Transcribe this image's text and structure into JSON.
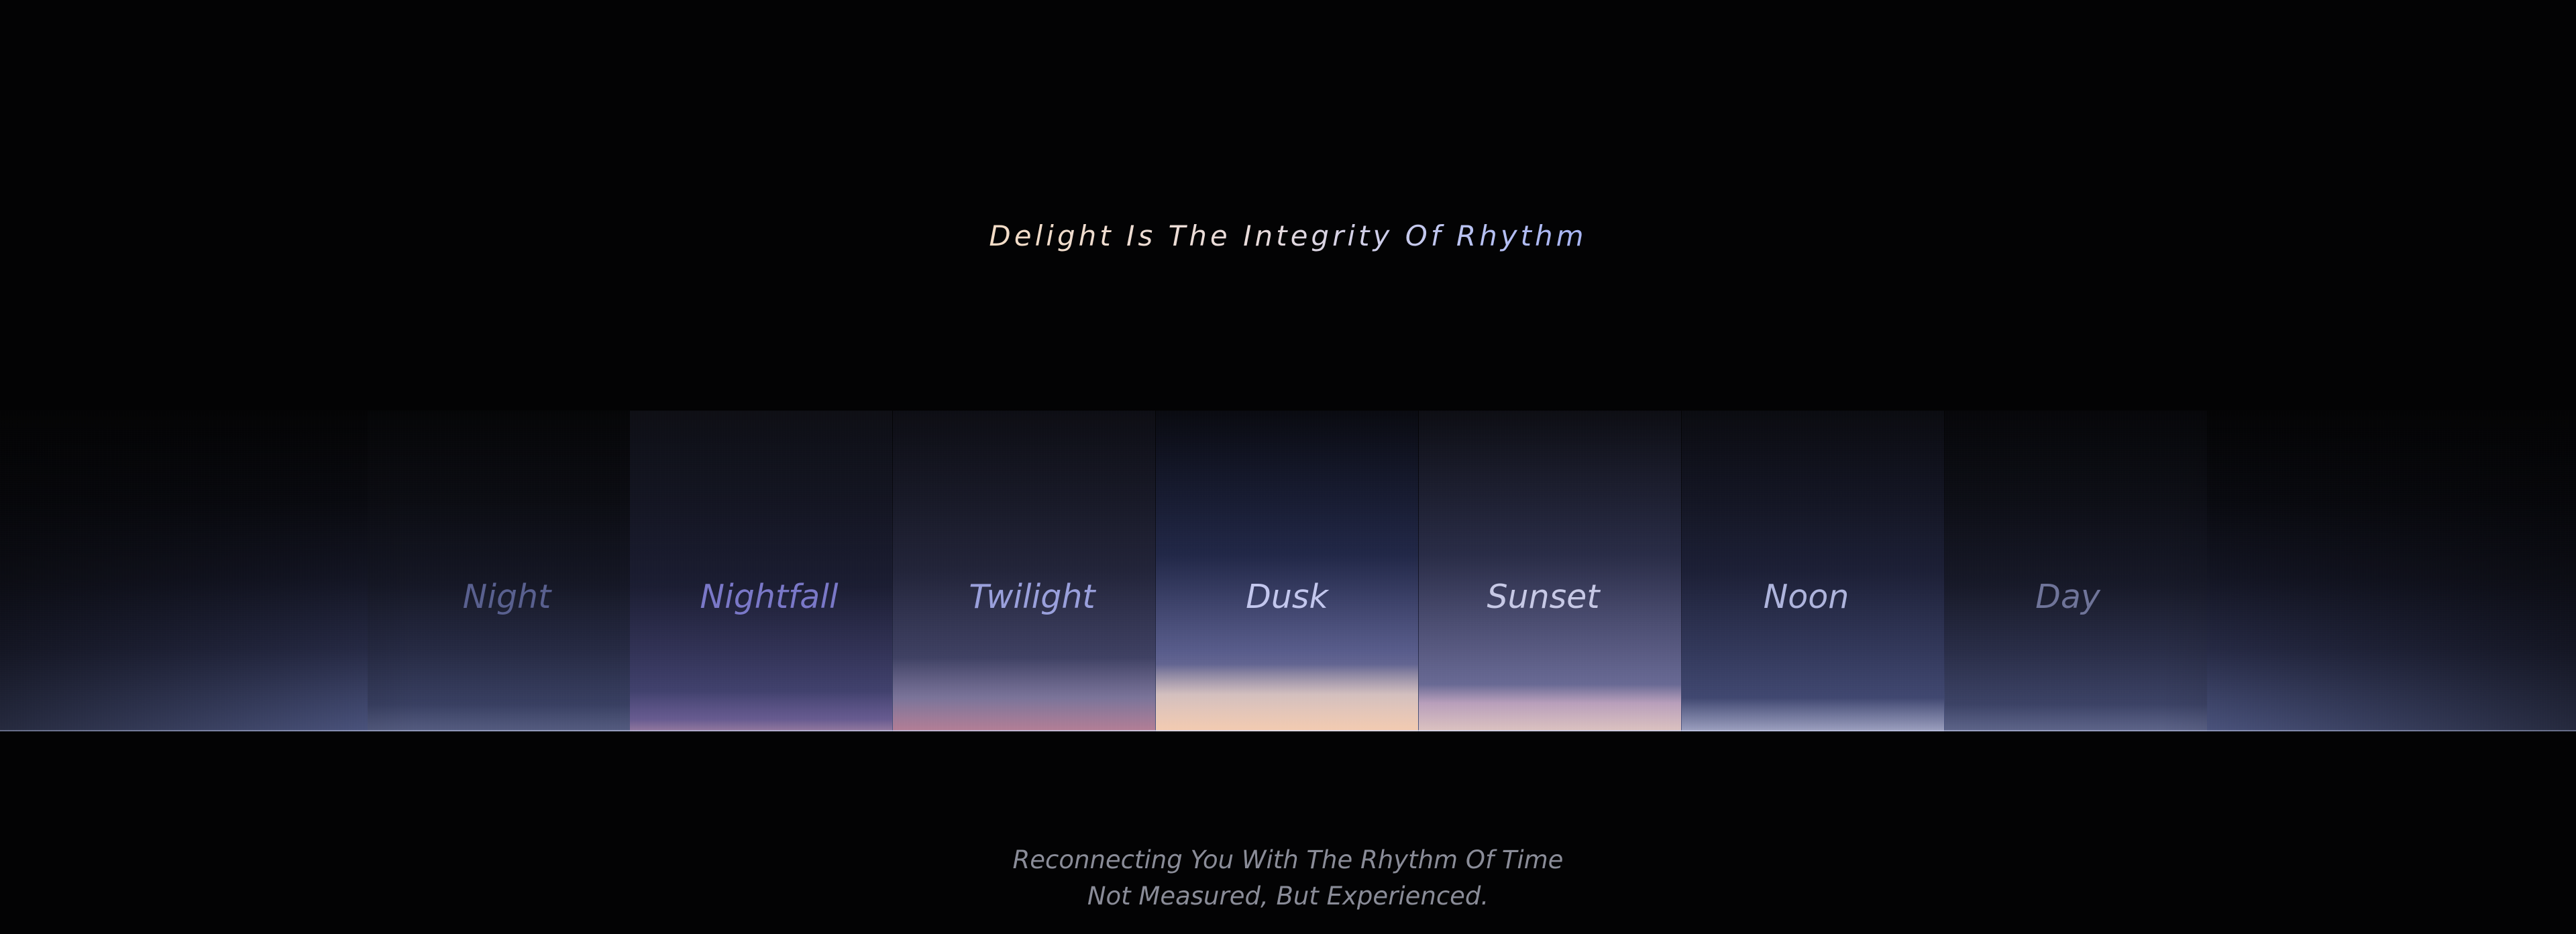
{
  "headline": "Delight Is The Integrity Of Rhythm",
  "phases": [
    {
      "id": "night",
      "label": "Night",
      "color": "#59608f"
    },
    {
      "id": "nightfall",
      "label": "Nightfall",
      "color": "#7a78c8"
    },
    {
      "id": "twilight",
      "label": "Twilight",
      "color": "#9aa0dc"
    },
    {
      "id": "dusk",
      "label": "Dusk",
      "color": "#c3c7ee"
    },
    {
      "id": "sunset",
      "label": "Sunset",
      "color": "#c7c9e6"
    },
    {
      "id": "noon",
      "label": "Noon",
      "color": "#aeb4dc"
    },
    {
      "id": "day",
      "label": "Day",
      "color": "#6f7499"
    }
  ],
  "footer": {
    "line1": "Reconnecting You With The Rhythm Of Time",
    "line2": "Not Measured, But Experienced."
  },
  "colors": {
    "background": "#030304",
    "headline_warm": "#f3dcc6",
    "headline_cool": "#a7b4f4",
    "footer_text": "#8a8c98",
    "horizon_glow": "#f8ceb0"
  }
}
